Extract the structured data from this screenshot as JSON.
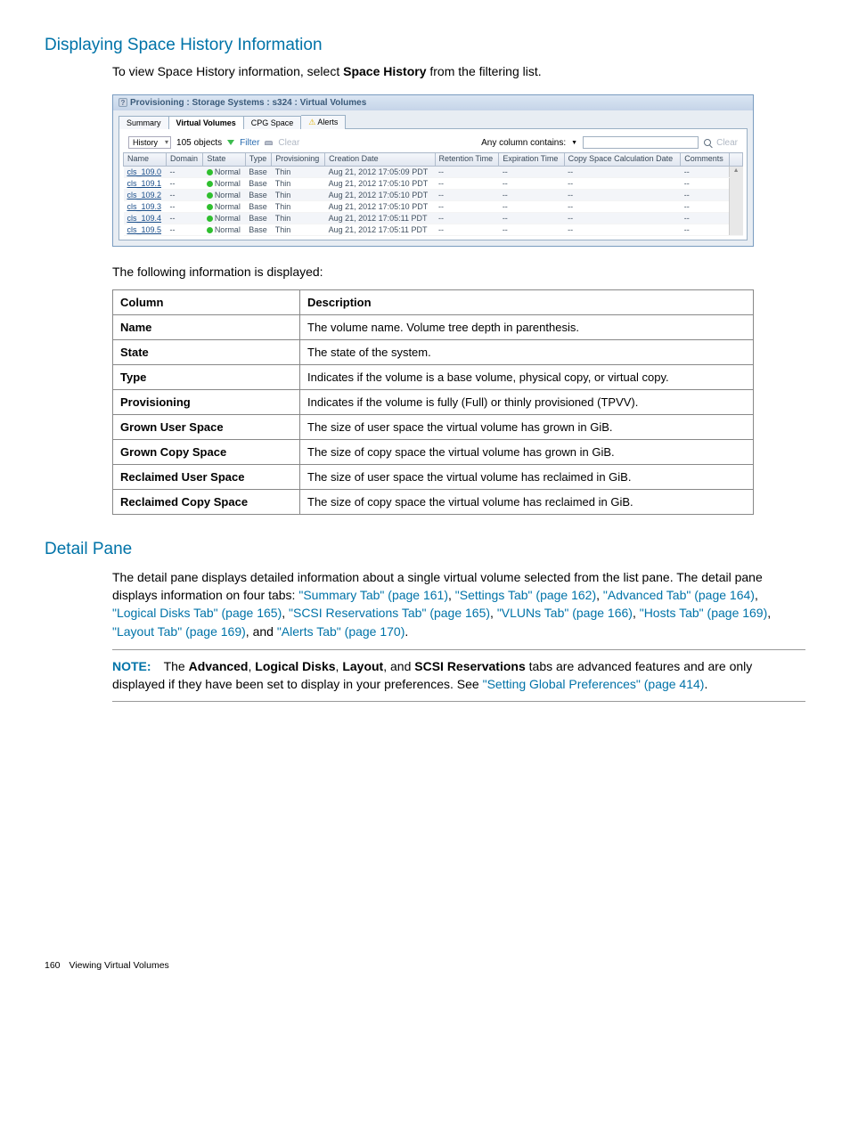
{
  "section1": {
    "heading": "Displaying Space History Information",
    "intro_pre": "To view Space History information, select ",
    "intro_bold": "Space History",
    "intro_post": " from the filtering list."
  },
  "screenshot": {
    "title": "Provisioning : Storage Systems : s324 : Virtual Volumes",
    "tabs": [
      {
        "label": "Summary",
        "active": false
      },
      {
        "label": "Virtual Volumes",
        "active": true
      },
      {
        "label": "CPG Space",
        "active": false
      },
      {
        "label": "Alerts",
        "active": false,
        "warn": true
      }
    ],
    "filter": {
      "dropdown": "History",
      "objects": "105 objects",
      "filter_label": "Filter",
      "clear_label": "Clear",
      "col_contains": "Any column contains:",
      "search_clear": "Clear"
    },
    "columns": [
      "Name",
      "Domain",
      "State",
      "Type",
      "Provisioning",
      "Creation Date",
      "Retention Time",
      "Expiration Time",
      "Copy Space Calculation Date",
      "Comments"
    ],
    "rows": [
      {
        "name": "cls_109.0",
        "domain": "--",
        "state": "Normal",
        "type": "Base",
        "prov": "Thin",
        "created": "Aug 21, 2012 17:05:09 PDT",
        "ret": "--",
        "exp": "--",
        "copy": "--",
        "comm": "--",
        "alt": true
      },
      {
        "name": "cls_109.1",
        "domain": "--",
        "state": "Normal",
        "type": "Base",
        "prov": "Thin",
        "created": "Aug 21, 2012 17:05:10 PDT",
        "ret": "--",
        "exp": "--",
        "copy": "--",
        "comm": "--",
        "alt": false
      },
      {
        "name": "cls_109.2",
        "domain": "--",
        "state": "Normal",
        "type": "Base",
        "prov": "Thin",
        "created": "Aug 21, 2012 17:05:10 PDT",
        "ret": "--",
        "exp": "--",
        "copy": "--",
        "comm": "--",
        "alt": true
      },
      {
        "name": "cls_109.3",
        "domain": "--",
        "state": "Normal",
        "type": "Base",
        "prov": "Thin",
        "created": "Aug 21, 2012 17:05:10 PDT",
        "ret": "--",
        "exp": "--",
        "copy": "--",
        "comm": "--",
        "alt": false
      },
      {
        "name": "cls_109.4",
        "domain": "--",
        "state": "Normal",
        "type": "Base",
        "prov": "Thin",
        "created": "Aug 21, 2012 17:05:11 PDT",
        "ret": "--",
        "exp": "--",
        "copy": "--",
        "comm": "--",
        "alt": true
      },
      {
        "name": "cls_109.5",
        "domain": "--",
        "state": "Normal",
        "type": "Base",
        "prov": "Thin",
        "created": "Aug 21, 2012 17:05:11 PDT",
        "ret": "--",
        "exp": "--",
        "copy": "--",
        "comm": "--",
        "alt": false
      }
    ]
  },
  "followup": "The following information is displayed:",
  "desc_headers": {
    "c1": "Column",
    "c2": "Description"
  },
  "desc_rows": [
    {
      "c1": "Name",
      "c2": "The volume name. Volume tree depth in parenthesis."
    },
    {
      "c1": "State",
      "c2": "The state of the system."
    },
    {
      "c1": "Type",
      "c2": "Indicates if the volume is a base volume, physical copy, or virtual copy."
    },
    {
      "c1": "Provisioning",
      "c2": "Indicates if the volume is fully (Full) or thinly provisioned (TPVV)."
    },
    {
      "c1": "Grown User Space",
      "c2": "The size of user space the virtual volume has grown in GiB."
    },
    {
      "c1": "Grown Copy Space",
      "c2": "The size of copy space the virtual volume has grown in GiB."
    },
    {
      "c1": "Reclaimed User Space",
      "c2": "The size of user space the virtual volume has reclaimed in GiB."
    },
    {
      "c1": "Reclaimed Copy Space",
      "c2": "The size of copy space the virtual volume has reclaimed in GiB."
    }
  ],
  "section2": {
    "heading": "Detail Pane",
    "para1_pre": "The detail pane displays detailed information about a single virtual volume selected from the list pane. The detail pane displays information on four tabs: ",
    "links": {
      "summary": "\"Summary Tab\" (page 161)",
      "settings": "\"Settings Tab\" (page 162)",
      "advanced": "\"Advanced Tab\" (page 164)",
      "logical": "\"Logical Disks Tab\" (page 165)",
      "scsi": "\"SCSI Reservations Tab\" (page 165)",
      "vluns": "\"VLUNs Tab\" (page 166)",
      "hosts": "\"Hosts Tab\" (page 169)",
      "layout": "\"Layout Tab\" (page 169)",
      "alerts": "\"Alerts Tab\" (page 170)"
    },
    "para1_end": ", and ",
    "para1_period": "."
  },
  "note": {
    "label": "NOTE:",
    "before": "The ",
    "b1": "Advanced",
    "s1": ", ",
    "b2": "Logical Disks",
    "s2": ", ",
    "b3": "Layout",
    "s3": ", and ",
    "b4": "SCSI Reservations",
    "after": " tabs are advanced features and are only displayed if they have been set to display in your preferences. See ",
    "link": "\"Setting Global Preferences\" (page 414)",
    "period": "."
  },
  "footer": {
    "page": "160",
    "section": "Viewing Virtual Volumes"
  }
}
